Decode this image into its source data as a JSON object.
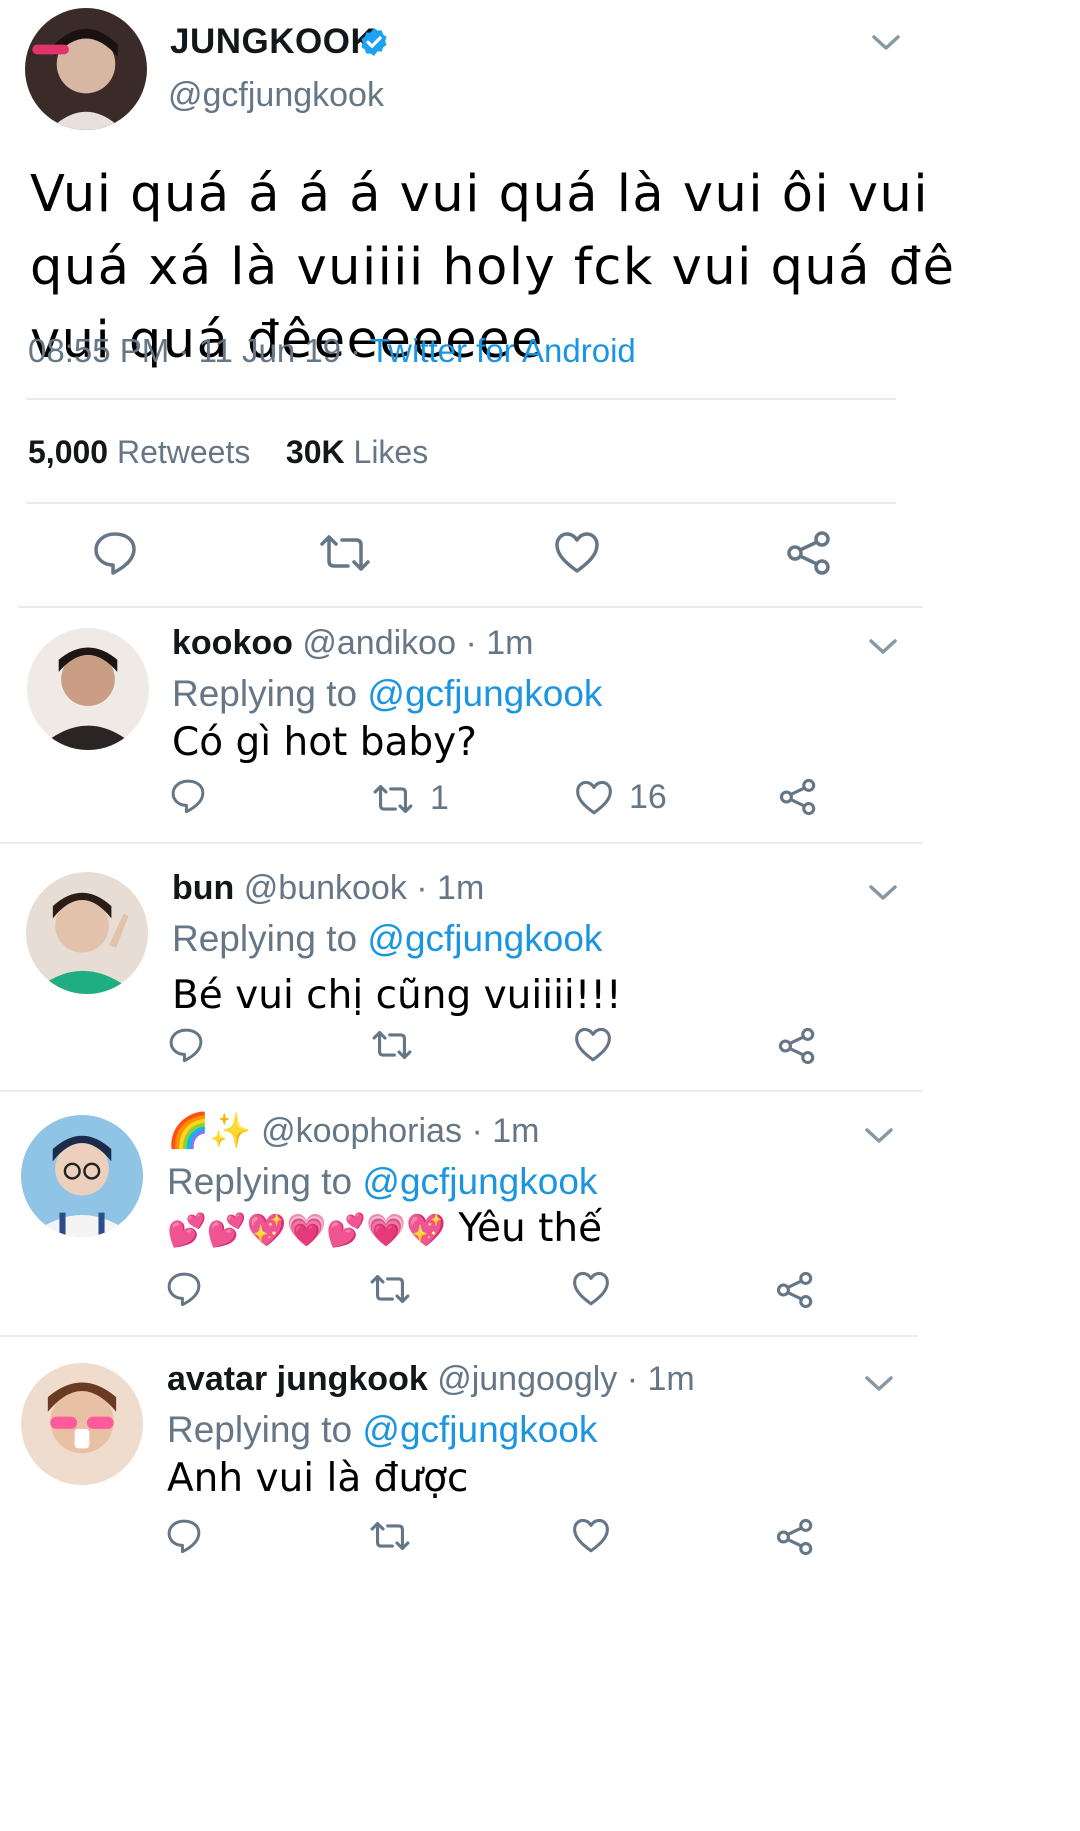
{
  "tweet": {
    "display_name": "JUNGKOOK",
    "handle": "@gcfjungkook",
    "text": "Vui quá á á á vui quá là vui ôi vui quá xá là vuiiii holy fck vui quá đê vui quá đêeeeeeee",
    "time": "08:55 PM · 11 Jun 19 · ",
    "source": "Twitter for Android",
    "retweets_count": "5,000",
    "retweets_label": "Retweets",
    "likes_count": "30K",
    "likes_label": "Likes",
    "verified_icon": "verified-badge-icon",
    "brand_color": "#1da1f2"
  },
  "replies": [
    {
      "name": "kookoo",
      "handle": "@andikoo",
      "time": "· 1m",
      "replying_prefix": "Replying to",
      "replying_to": "@gcfjungkook",
      "text": "Có gì hot baby?",
      "retweets": "1",
      "likes": "16"
    },
    {
      "name": "bun",
      "handle": "@bunkook",
      "time": "· 1m",
      "replying_prefix": "Replying to",
      "replying_to": "@gcfjungkook",
      "text": "Bé vui chị cũng vuiiii!!!",
      "retweets": "",
      "likes": ""
    },
    {
      "name": "🌈✨",
      "handle": "@koophorias",
      "time": "· 1m",
      "replying_prefix": "Replying to",
      "replying_to": "@gcfjungkook",
      "emojis": "💕💕💖💗💕💗💖",
      "text": "Yêu thế",
      "retweets": "",
      "likes": ""
    },
    {
      "name": "avatar jungkook",
      "handle": "@jungoogly",
      "time": "· 1m",
      "replying_prefix": "Replying to",
      "replying_to": "@gcfjungkook",
      "text": "Anh vui là được",
      "retweets": "",
      "likes": ""
    }
  ],
  "icons": {
    "reply": "reply-icon",
    "retweet": "retweet-icon",
    "like": "like-icon",
    "share": "share-icon",
    "menu": "chevron-down-icon"
  }
}
